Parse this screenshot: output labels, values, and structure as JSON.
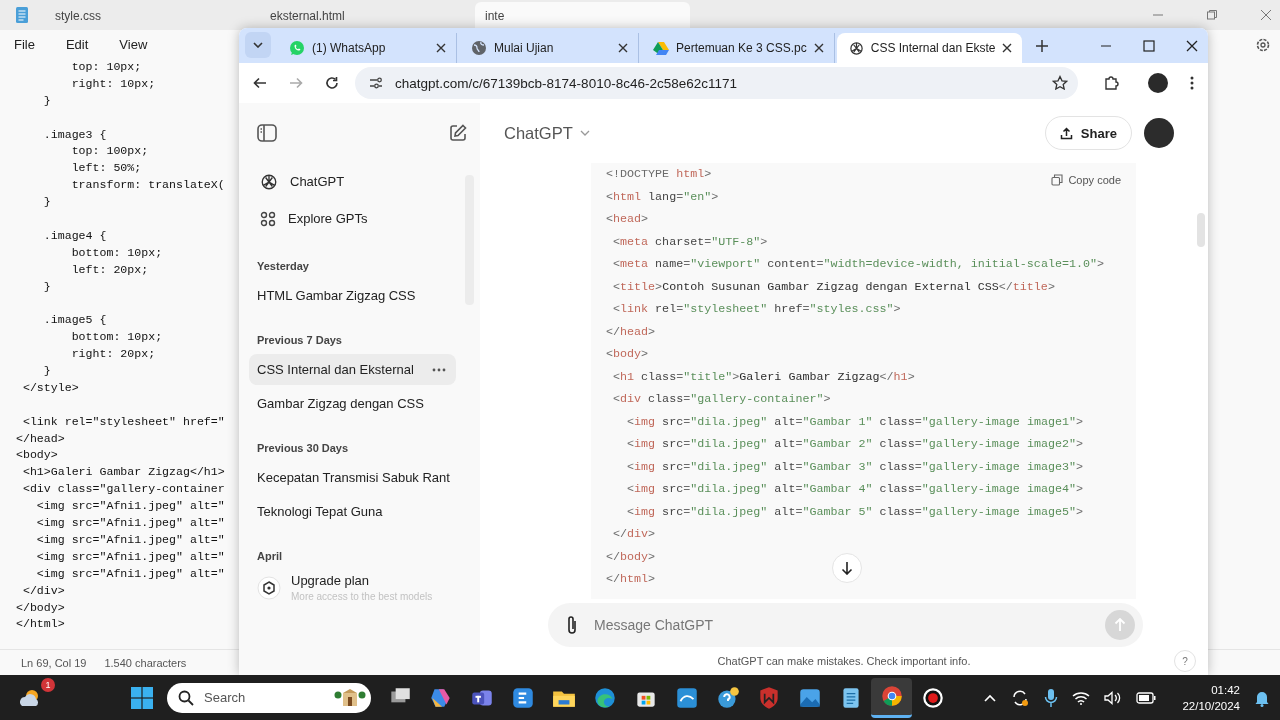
{
  "notepad": {
    "tabs": [
      {
        "label": "style.css",
        "selected": false
      },
      {
        "label": "eksternal.html",
        "selected": false
      },
      {
        "label": "inte",
        "selected": true
      }
    ],
    "menu": [
      "File",
      "Edit",
      "View"
    ],
    "code_blocks": [
      [
        "        top: 10px;",
        "        right: 10px;",
        "    }"
      ],
      [
        "    .image3 {",
        "        top: 100px;",
        "        left: 50%;",
        "        transform: translateX(",
        "    }"
      ],
      [
        "    .image4 {",
        "        bottom: 10px;",
        "        left: 20px;",
        "    }"
      ],
      [
        "    .image5 {",
        "        bottom: 10px;",
        "        right: 20px;",
        "    }",
        " </style>"
      ],
      [
        " <link rel=\"stylesheet\" href=\"",
        "</head>",
        "<body>",
        " <h1>Galeri Gambar Zigzag</h1>",
        " <div class=\"gallery-container",
        "   <img src=\"Afni1.jpeg\" alt=\"",
        "   <img src=\"Afni1.jpeg\" alt=\"",
        "   <img src=\"Afni1.jpeg\" alt=\"",
        "   <img src=\"Afni1.jpeg\" alt=\"",
        "   <img src=\"Afni1.jpeg\" alt=\"",
        " </div>",
        "</body>",
        "</html>"
      ]
    ],
    "status": [
      "Ln 69, Col 19",
      "1.540 characters"
    ]
  },
  "browser": {
    "tabs": [
      {
        "label": "(1) WhatsApp",
        "kind": "whatsapp",
        "selected": false
      },
      {
        "label": "Mulai Ujian",
        "kind": "globe",
        "selected": false
      },
      {
        "label": "Pertemuan Ke 3 CSS.pc",
        "kind": "drive",
        "selected": false
      },
      {
        "label": "CSS Internal dan Ekste",
        "kind": "chatgpt",
        "selected": true
      }
    ],
    "url": "chatgpt.com/c/67139bcb-8174-8010-8c46-2c58e62c1171",
    "sidebar": {
      "nav": [
        {
          "label": "ChatGPT",
          "kind": "chatgpt"
        },
        {
          "label": "Explore GPTs",
          "kind": "grid"
        }
      ],
      "sections": [
        {
          "heading": "Yesterday",
          "items": [
            {
              "title": "HTML Gambar Zigzag CSS",
              "selected": false
            }
          ]
        },
        {
          "heading": "Previous 7 Days",
          "items": [
            {
              "title": "CSS Internal dan Eksternal",
              "selected": true
            },
            {
              "title": "Gambar Zigzag dengan CSS",
              "selected": false
            }
          ]
        },
        {
          "heading": "Previous 30 Days",
          "items": [
            {
              "title": "Kecepatan Transmisi Sabuk Rant",
              "selected": false
            },
            {
              "title": "Teknologi Tepat Guna",
              "selected": false
            }
          ]
        },
        {
          "heading": "April"
        }
      ],
      "upgrade": {
        "title": "Upgrade plan",
        "subtitle": "More access to the best models"
      }
    },
    "chat": {
      "model": "ChatGPT",
      "share": "Share",
      "copy": "Copy code",
      "code": [
        [
          {
            "kind": "punct",
            "text": "<!DOCTYPE "
          },
          {
            "kind": "tag",
            "text": "html"
          },
          {
            "kind": "punct",
            "text": ">"
          }
        ],
        [
          {
            "kind": "punct",
            "text": "<"
          },
          {
            "kind": "tag",
            "text": "html"
          },
          {
            "kind": "attr",
            "text": " lang"
          },
          {
            "kind": "punct",
            "text": "="
          },
          {
            "kind": "string",
            "text": "\"en\""
          },
          {
            "kind": "punct",
            "text": ">"
          }
        ],
        [
          {
            "kind": "punct",
            "text": "<"
          },
          {
            "kind": "tag",
            "text": "head"
          },
          {
            "kind": "punct",
            "text": ">"
          }
        ],
        [
          {
            "kind": "punct",
            "text": " <"
          },
          {
            "kind": "tag",
            "text": "meta"
          },
          {
            "kind": "attr",
            "text": " charset"
          },
          {
            "kind": "punct",
            "text": "="
          },
          {
            "kind": "string",
            "text": "\"UTF-8\""
          },
          {
            "kind": "punct",
            "text": ">"
          }
        ],
        [
          {
            "kind": "punct",
            "text": " <"
          },
          {
            "kind": "tag",
            "text": "meta"
          },
          {
            "kind": "attr",
            "text": " name"
          },
          {
            "kind": "punct",
            "text": "="
          },
          {
            "kind": "string",
            "text": "\"viewport\""
          },
          {
            "kind": "attr",
            "text": " content"
          },
          {
            "kind": "punct",
            "text": "="
          },
          {
            "kind": "string",
            "text": "\"width=device-width, initial-scale=1.0\""
          },
          {
            "kind": "punct",
            "text": ">"
          }
        ],
        [
          {
            "kind": "punct",
            "text": " <"
          },
          {
            "kind": "tag",
            "text": "title"
          },
          {
            "kind": "punct",
            "text": ">"
          },
          {
            "kind": "text",
            "text": "Contoh Susunan Gambar Zigzag dengan External CSS"
          },
          {
            "kind": "punct",
            "text": "</"
          },
          {
            "kind": "tag",
            "text": "title"
          },
          {
            "kind": "punct",
            "text": ">"
          }
        ],
        [
          {
            "kind": "punct",
            "text": " <"
          },
          {
            "kind": "tag",
            "text": "link"
          },
          {
            "kind": "attr",
            "text": " rel"
          },
          {
            "kind": "punct",
            "text": "="
          },
          {
            "kind": "string",
            "text": "\"stylesheet\""
          },
          {
            "kind": "attr",
            "text": " href"
          },
          {
            "kind": "punct",
            "text": "="
          },
          {
            "kind": "string",
            "text": "\"styles.css\""
          },
          {
            "kind": "punct",
            "text": ">"
          }
        ],
        [
          {
            "kind": "punct",
            "text": "</"
          },
          {
            "kind": "tag",
            "text": "head"
          },
          {
            "kind": "punct",
            "text": ">"
          }
        ],
        [
          {
            "kind": "punct",
            "text": "<"
          },
          {
            "kind": "tag",
            "text": "body"
          },
          {
            "kind": "punct",
            "text": ">"
          }
        ],
        [
          {
            "kind": "punct",
            "text": " <"
          },
          {
            "kind": "tag",
            "text": "h1"
          },
          {
            "kind": "attr",
            "text": " class"
          },
          {
            "kind": "punct",
            "text": "="
          },
          {
            "kind": "string",
            "text": "\"title\""
          },
          {
            "kind": "punct",
            "text": ">"
          },
          {
            "kind": "text",
            "text": "Galeri Gambar Zigzag"
          },
          {
            "kind": "punct",
            "text": "</"
          },
          {
            "kind": "tag",
            "text": "h1"
          },
          {
            "kind": "punct",
            "text": ">"
          }
        ],
        [
          {
            "kind": "punct",
            "text": " <"
          },
          {
            "kind": "tag",
            "text": "div"
          },
          {
            "kind": "attr",
            "text": " class"
          },
          {
            "kind": "punct",
            "text": "="
          },
          {
            "kind": "string",
            "text": "\"gallery-container\""
          },
          {
            "kind": "punct",
            "text": ">"
          }
        ],
        [
          {
            "kind": "punct",
            "text": "   <"
          },
          {
            "kind": "tag",
            "text": "img"
          },
          {
            "kind": "attr",
            "text": " src"
          },
          {
            "kind": "punct",
            "text": "="
          },
          {
            "kind": "string",
            "text": "\"dila.jpeg\""
          },
          {
            "kind": "attr",
            "text": " alt"
          },
          {
            "kind": "punct",
            "text": "="
          },
          {
            "kind": "string",
            "text": "\"Gambar 1\""
          },
          {
            "kind": "attr",
            "text": " class"
          },
          {
            "kind": "punct",
            "text": "="
          },
          {
            "kind": "string",
            "text": "\"gallery-image image1\""
          },
          {
            "kind": "punct",
            "text": ">"
          }
        ],
        [
          {
            "kind": "punct",
            "text": "   <"
          },
          {
            "kind": "tag",
            "text": "img"
          },
          {
            "kind": "attr",
            "text": " src"
          },
          {
            "kind": "punct",
            "text": "="
          },
          {
            "kind": "string",
            "text": "\"dila.jpeg\""
          },
          {
            "kind": "attr",
            "text": " alt"
          },
          {
            "kind": "punct",
            "text": "="
          },
          {
            "kind": "string",
            "text": "\"Gambar 2\""
          },
          {
            "kind": "attr",
            "text": " class"
          },
          {
            "kind": "punct",
            "text": "="
          },
          {
            "kind": "string",
            "text": "\"gallery-image image2\""
          },
          {
            "kind": "punct",
            "text": ">"
          }
        ],
        [
          {
            "kind": "punct",
            "text": "   <"
          },
          {
            "kind": "tag",
            "text": "img"
          },
          {
            "kind": "attr",
            "text": " src"
          },
          {
            "kind": "punct",
            "text": "="
          },
          {
            "kind": "string",
            "text": "\"dila.jpeg\""
          },
          {
            "kind": "attr",
            "text": " alt"
          },
          {
            "kind": "punct",
            "text": "="
          },
          {
            "kind": "string",
            "text": "\"Gambar 3\""
          },
          {
            "kind": "attr",
            "text": " class"
          },
          {
            "kind": "punct",
            "text": "="
          },
          {
            "kind": "string",
            "text": "\"gallery-image image3\""
          },
          {
            "kind": "punct",
            "text": ">"
          }
        ],
        [
          {
            "kind": "punct",
            "text": "   <"
          },
          {
            "kind": "tag",
            "text": "img"
          },
          {
            "kind": "attr",
            "text": " src"
          },
          {
            "kind": "punct",
            "text": "="
          },
          {
            "kind": "string",
            "text": "\"dila.jpeg\""
          },
          {
            "kind": "attr",
            "text": " alt"
          },
          {
            "kind": "punct",
            "text": "="
          },
          {
            "kind": "string",
            "text": "\"Gambar 4\""
          },
          {
            "kind": "attr",
            "text": " class"
          },
          {
            "kind": "punct",
            "text": "="
          },
          {
            "kind": "string",
            "text": "\"gallery-image image4\""
          },
          {
            "kind": "punct",
            "text": ">"
          }
        ],
        [
          {
            "kind": "punct",
            "text": "   <"
          },
          {
            "kind": "tag",
            "text": "img"
          },
          {
            "kind": "attr",
            "text": " src"
          },
          {
            "kind": "punct",
            "text": "="
          },
          {
            "kind": "string",
            "text": "\"dila.jpeg\""
          },
          {
            "kind": "attr",
            "text": " alt"
          },
          {
            "kind": "punct",
            "text": "="
          },
          {
            "kind": "string",
            "text": "\"Gambar 5\""
          },
          {
            "kind": "attr",
            "text": " class"
          },
          {
            "kind": "punct",
            "text": "="
          },
          {
            "kind": "string",
            "text": "\"gallery-image image5\""
          },
          {
            "kind": "punct",
            "text": ">"
          }
        ],
        [
          {
            "kind": "punct",
            "text": " </"
          },
          {
            "kind": "tag",
            "text": "div"
          },
          {
            "kind": "punct",
            "text": ">"
          }
        ],
        [
          {
            "kind": "punct",
            "text": "</"
          },
          {
            "kind": "tag",
            "text": "body"
          },
          {
            "kind": "punct",
            "text": ">"
          }
        ],
        [
          {
            "kind": "punct",
            "text": "</"
          },
          {
            "kind": "tag",
            "text": "html"
          },
          {
            "kind": "punct",
            "text": ">"
          }
        ]
      ],
      "placeholder": "Message ChatGPT",
      "disclaimer": "ChatGPT can make mistakes. Check important info.",
      "help": "?"
    }
  },
  "taskbar": {
    "weather_badge": "1",
    "search_placeholder": "Search",
    "time": "01:42",
    "date": "22/10/2024"
  }
}
